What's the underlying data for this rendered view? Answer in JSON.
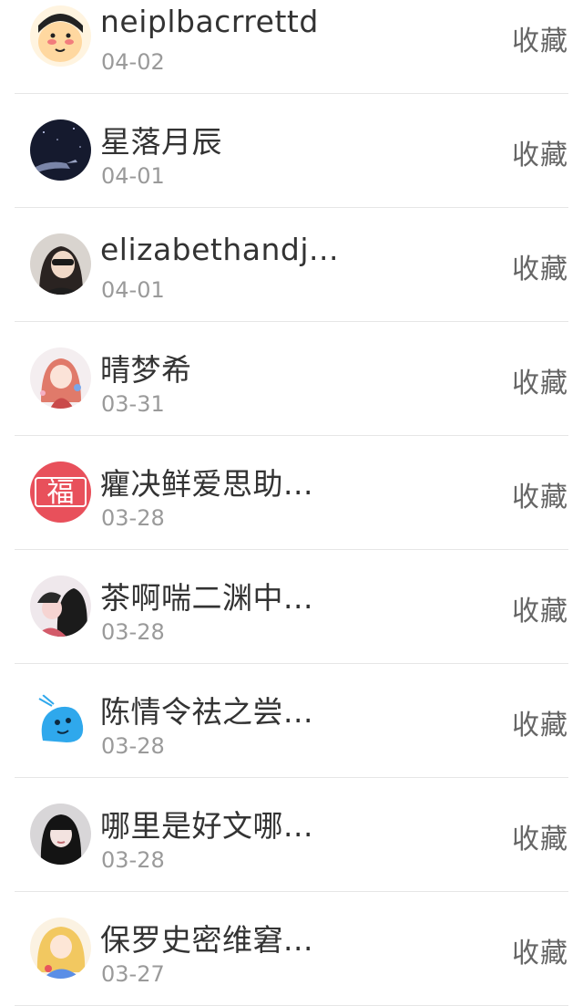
{
  "favorites": {
    "items": [
      {
        "name": "neiplbacrrettd",
        "date": "04-02",
        "action": "收藏",
        "avatar_icon": "cartoon-face-avatar"
      },
      {
        "name": "星落月辰",
        "date": "04-01",
        "action": "收藏",
        "avatar_icon": "night-sky-avatar"
      },
      {
        "name": "elizabethandj...",
        "date": "04-01",
        "action": "收藏",
        "avatar_icon": "woman-selfie-avatar"
      },
      {
        "name": "晴梦希",
        "date": "03-31",
        "action": "收藏",
        "avatar_icon": "anime-girl-avatar"
      },
      {
        "name": "癯决鲜爱思助...",
        "date": "03-28",
        "action": "收藏",
        "avatar_icon": "fu-character-avatar",
        "avatar_text": "福"
      },
      {
        "name": "茶啊喘二渊中...",
        "date": "03-28",
        "action": "收藏",
        "avatar_icon": "anime-couple-avatar"
      },
      {
        "name": "陈情令祛之尝...",
        "date": "03-28",
        "action": "收藏",
        "avatar_icon": "blue-cartoon-avatar"
      },
      {
        "name": "哪里是好文哪...",
        "date": "03-28",
        "action": "收藏",
        "avatar_icon": "dark-hair-girl-avatar"
      },
      {
        "name": "保罗史密维窘...",
        "date": "03-27",
        "action": "收藏",
        "avatar_icon": "blonde-anime-avatar"
      }
    ]
  },
  "colors": {
    "name_text": "#333333",
    "date_text": "#9a9a9a",
    "action_text": "#666666",
    "divider": "#e6e6e6",
    "fu_red": "#e8505b"
  }
}
